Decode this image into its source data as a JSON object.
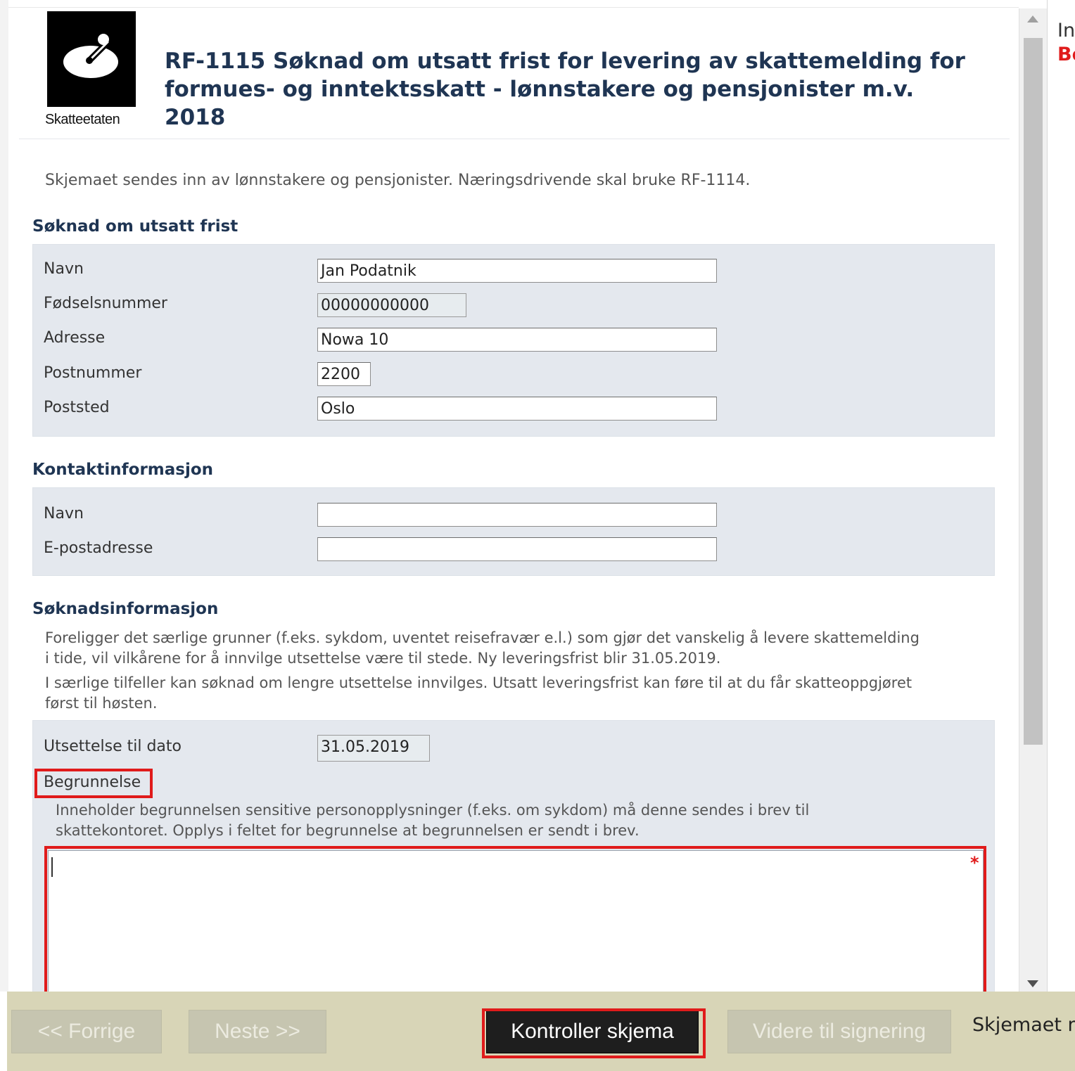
{
  "header": {
    "logo_label": "Skatteetaten",
    "title_line1": "RF-1115 Søknad om utsatt frist for levering av skattemelding for",
    "title_line2": "formues- og inntektsskatt - lønnstakere og pensjonister m.v. 2018"
  },
  "intro": "Skjemaet sendes inn av lønnstakere og pensjonister. Næringsdrivende skal bruke RF-1114.",
  "soknad": {
    "heading": "Søknad om utsatt frist",
    "navn_label": "Navn",
    "navn_value": "Jan Podatnik",
    "fnr_label": "Fødselsnummer",
    "fnr_value": "00000000000",
    "adresse_label": "Adresse",
    "adresse_value": "Nowa 10",
    "postnr_label": "Postnummer",
    "postnr_value": "2200",
    "poststed_label": "Poststed",
    "poststed_value": "Oslo"
  },
  "kontakt": {
    "heading": "Kontaktinformasjon",
    "navn_label": "Navn",
    "navn_value": "",
    "epost_label": "E-postadresse",
    "epost_value": ""
  },
  "soknadsinfo": {
    "heading": "Søknadsinformasjon",
    "para1_line1": "Foreligger det særlige grunner (f.eks. sykdom, uventet reisefravær e.l.) som gjør det vanskelig å levere skattemelding",
    "para1_line2": "i tide, vil vilkårene for å innvilge utsettelse være til stede. Ny leveringsfrist blir 31.05.2019.",
    "para2_line1": "I særlige tilfeller kan søknad om lengre utsettelse innvilges. Utsatt leveringsfrist kan føre til at du får skatteoppgjøret",
    "para2_line2": "først til høsten.",
    "dato_label": "Utsettelse til dato",
    "dato_value": "31.05.2019",
    "begrunnelse_label": "Begrunnelse",
    "begrunnelse_help_line1": "Inneholder begrunnelsen sensitive personopplysninger (f.eks. om sykdom) må denne sendes i brev til",
    "begrunnelse_help_line2": "skattekontoret. Opplys i feltet for begrunnelse at begrunnelsen er sendt i brev.",
    "begrunnelse_value": "",
    "required_mark": "*"
  },
  "right_pane": {
    "text1": "In",
    "text2": "Be"
  },
  "footer": {
    "prev": "<< Forrige",
    "next": "Neste >>",
    "check": "Kontroller skjema",
    "sign": "Videre til signering",
    "status": "Skjemaet m"
  },
  "colors": {
    "accent_red": "#e01b1b",
    "heading_blue": "#1f3553",
    "footer_bg": "#d8d5b7",
    "panel_bg": "#e4e8ee"
  }
}
